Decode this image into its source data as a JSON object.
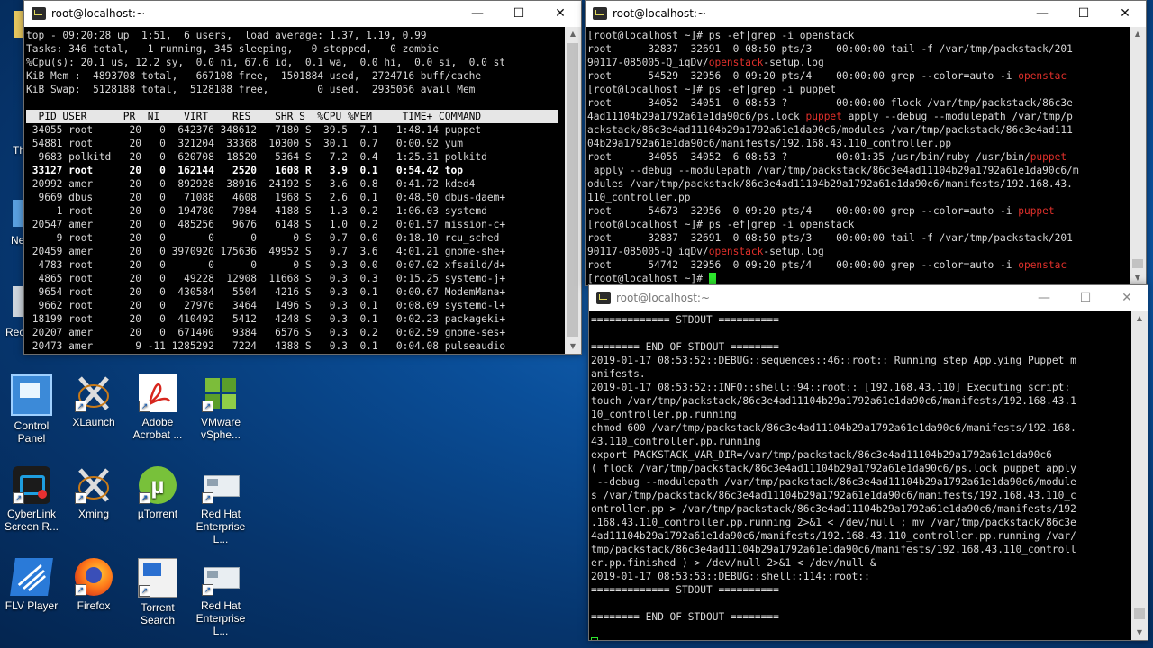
{
  "windows": {
    "top_win": {
      "title": "root@localhost:~",
      "summary": [
        "top - 09:20:28 up  1:51,  6 users,  load average: 1.37, 1.19, 0.99",
        "Tasks: 346 total,   1 running, 345 sleeping,   0 stopped,   0 zombie",
        "%Cpu(s): 20.1 us, 12.2 sy,  0.0 ni, 67.6 id,  0.1 wa,  0.0 hi,  0.0 si,  0.0 st",
        "KiB Mem :  4893708 total,   667108 free,  1501884 used,  2724716 buff/cache",
        "KiB Swap:  5128188 total,  5128188 free,        0 used.  2935056 avail Mem"
      ],
      "header": "  PID USER      PR  NI    VIRT    RES    SHR S  %CPU %MEM     TIME+ COMMAND",
      "rows": [
        "34055 root      20   0  642376 348612   7180 S  39.5  7.1   1:48.14 puppet",
        "54881 root      20   0  321204  33368  10300 S  30.1  0.7   0:00.92 yum",
        " 9683 polkitd   20   0  620708  18520   5364 S   7.2  0.4   1:25.31 polkitd",
        "33127 root      20   0  162144   2520   1608 R   3.9  0.1   0:54.42 top",
        "20992 amer      20   0  892928  38916  24192 S   3.6  0.8   0:41.72 kded4",
        " 9669 dbus      20   0   71088   4608   1968 S   2.6  0.1   0:48.50 dbus-daem+",
        "    1 root      20   0  194780   7984   4188 S   1.3  0.2   1:06.03 systemd",
        "20547 amer      20   0  485256   9676   6148 S   1.0  0.2   0:01.57 mission-c+",
        "    9 root      20   0       0      0      0 S   0.7  0.0   0:18.10 rcu_sched",
        "20459 amer      20   0 3970920 175636  49952 S   0.7  3.6   4:01.21 gnome-she+",
        " 4783 root      20   0       0      0      0 S   0.3  0.0   0:07.02 xfsaild/d+",
        " 4865 root      20   0   49228  12908  11668 S   0.3  0.3   0:15.25 systemd-j+",
        " 9654 root      20   0  430584   5504   4216 S   0.3  0.1   0:00.67 ModemMana+",
        " 9662 root      20   0   27976   3464   1496 S   0.3  0.1   0:08.69 systemd-l+",
        "18199 root      20   0  410492   5412   4248 S   0.3  0.1   0:02.23 packageki+",
        "20207 amer      20   0  671400   9384   6576 S   0.3  0.2   0:02.59 gnome-ses+",
        "20473 amer       9 -11 1285292   7224   4388 S   0.3  0.1   0:04.08 pulseaudio"
      ]
    },
    "ps_win": {
      "title": "root@localhost:~",
      "lines": [
        [
          "[root@localhost ~]# ps -ef|grep -i openstack",
          ""
        ],
        [
          "root      32837  32691  0 08:50 pts/3    00:00:00 tail -f /var/tmp/packstack/201",
          ""
        ],
        [
          "90117-085005-Q_iqDv/",
          "openstack",
          "-setup.log"
        ],
        [
          "root      54529  32956  0 09:20 pts/4    00:00:00 grep --color=auto -i ",
          "openstac",
          ""
        ],
        [
          "[root@localhost ~]# ps -ef|grep -i puppet",
          ""
        ],
        [
          "root      34052  34051  0 08:53 ?        00:00:00 flock /var/tmp/packstack/86c3e",
          ""
        ],
        [
          "4ad11104b29a1792a61e1da90c6/ps.lock ",
          "puppet",
          " apply --debug --modulepath /var/tmp/p"
        ],
        [
          "ackstack/86c3e4ad11104b29a1792a61e1da90c6/modules /var/tmp/packstack/86c3e4ad111",
          ""
        ],
        [
          "04b29a1792a61e1da90c6/manifests/192.168.43.110_controller.pp",
          ""
        ],
        [
          "root      34055  34052  6 08:53 ?        00:01:35 /usr/bin/ruby /usr/bin/",
          "puppet",
          ""
        ],
        [
          " apply --debug --modulepath /var/tmp/packstack/86c3e4ad11104b29a1792a61e1da90c6/m",
          ""
        ],
        [
          "odules /var/tmp/packstack/86c3e4ad11104b29a1792a61e1da90c6/manifests/192.168.43.",
          ""
        ],
        [
          "110_controller.pp",
          ""
        ],
        [
          "root      54673  32956  0 09:20 pts/4    00:00:00 grep --color=auto -i ",
          "puppet",
          ""
        ],
        [
          "[root@localhost ~]# ps -ef|grep -i openstack",
          ""
        ],
        [
          "root      32837  32691  0 08:50 pts/3    00:00:00 tail -f /var/tmp/packstack/201",
          ""
        ],
        [
          "90117-085005-Q_iqDv/",
          "openstack",
          "-setup.log"
        ],
        [
          "root      54742  32956  0 09:20 pts/4    00:00:00 grep --color=auto -i ",
          "openstac",
          ""
        ]
      ],
      "prompt": "[root@localhost ~]# "
    },
    "log_win": {
      "title": "root@localhost:~",
      "lines": [
        "============= STDOUT ==========",
        "",
        "======== END OF STDOUT ========",
        "2019-01-17 08:53:52::DEBUG::sequences::46::root:: Running step Applying Puppet m",
        "anifests.",
        "2019-01-17 08:53:52::INFO::shell::94::root:: [192.168.43.110] Executing script:",
        "touch /var/tmp/packstack/86c3e4ad11104b29a1792a61e1da90c6/manifests/192.168.43.1",
        "10_controller.pp.running",
        "chmod 600 /var/tmp/packstack/86c3e4ad11104b29a1792a61e1da90c6/manifests/192.168.",
        "43.110_controller.pp.running",
        "export PACKSTACK_VAR_DIR=/var/tmp/packstack/86c3e4ad11104b29a1792a61e1da90c6",
        "( flock /var/tmp/packstack/86c3e4ad11104b29a1792a61e1da90c6/ps.lock puppet apply",
        " --debug --modulepath /var/tmp/packstack/86c3e4ad11104b29a1792a61e1da90c6/module",
        "s /var/tmp/packstack/86c3e4ad11104b29a1792a61e1da90c6/manifests/192.168.43.110_c",
        "ontroller.pp > /var/tmp/packstack/86c3e4ad11104b29a1792a61e1da90c6/manifests/192",
        ".168.43.110_controller.pp.running 2>&1 < /dev/null ; mv /var/tmp/packstack/86c3e",
        "4ad11104b29a1792a61e1da90c6/manifests/192.168.43.110_controller.pp.running /var/",
        "tmp/packstack/86c3e4ad11104b29a1792a61e1da90c6/manifests/192.168.43.110_controll",
        "er.pp.finished ) > /dev/null 2>&1 < /dev/null &",
        "2019-01-17 08:53:53::DEBUG::shell::114::root::",
        "============= STDOUT ==========",
        "",
        "======== END OF STDOUT ========"
      ]
    }
  },
  "desktop": {
    "icons": [
      {
        "label": "Control Panel",
        "icon": "control-panel-icon"
      },
      {
        "label": "XLaunch",
        "icon": "xlaunch-icon"
      },
      {
        "label": "Adobe Acrobat ...",
        "icon": "acrobat-icon"
      },
      {
        "label": "VMware vSphe...",
        "icon": "vmware-icon"
      },
      {
        "label": "CyberLink Screen R...",
        "icon": "cyberlink-icon"
      },
      {
        "label": "Xming",
        "icon": "xming-icon"
      },
      {
        "label": "µTorrent",
        "icon": "utorrent-icon"
      },
      {
        "label": "Red Hat Enterprise L...",
        "icon": "redhat-icon"
      },
      {
        "label": "FLV Player",
        "icon": "flv-player-icon"
      },
      {
        "label": "Firefox",
        "icon": "firefox-icon"
      },
      {
        "label": "Torrent Search",
        "icon": "torrent-search-icon"
      },
      {
        "label": "Red Hat Enterprise L...",
        "icon": "redhat-icon"
      }
    ],
    "edge_labels": [
      "Th",
      "Ne",
      "Recy"
    ]
  },
  "colors": {
    "highlight": "#e0302b",
    "cursor": "#2ee82e",
    "terminal_bg": "#000000"
  }
}
